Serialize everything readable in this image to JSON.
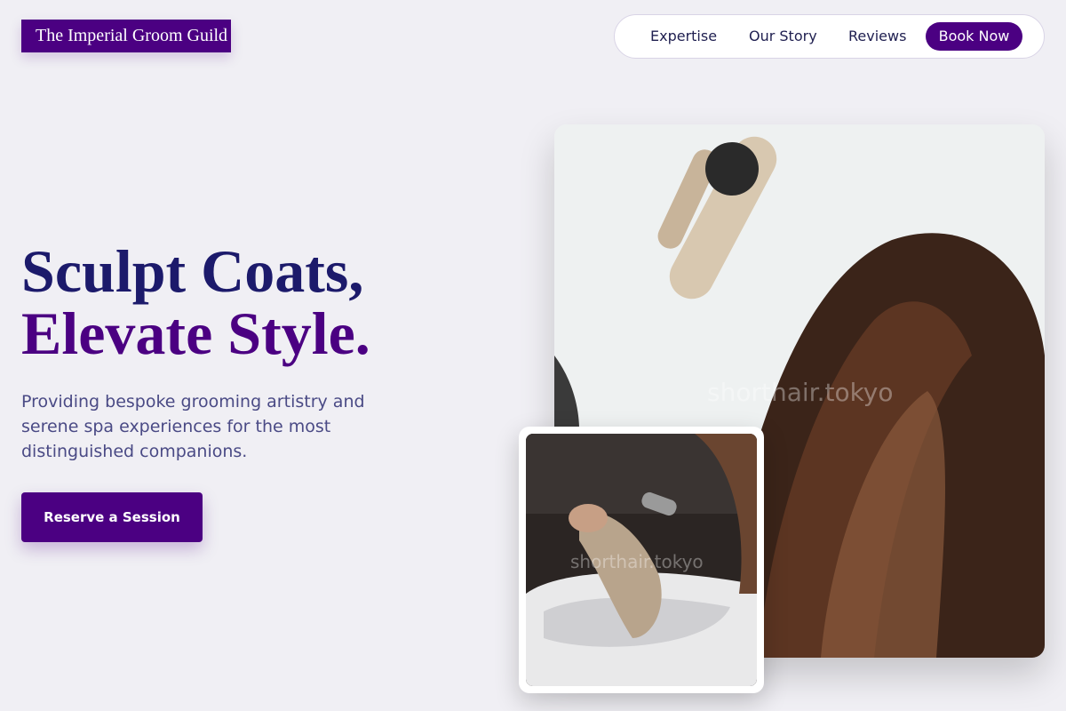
{
  "brand": {
    "name": "The Imperial Groom Guild"
  },
  "nav": {
    "links": [
      "Expertise",
      "Our Story",
      "Reviews"
    ],
    "cta": "Book Now"
  },
  "hero": {
    "headline_line1": "Sculpt Coats,",
    "headline_line2": "Elevate Style.",
    "subtext": "Providing bespoke grooming artistry and serene spa experiences for the most distinguished companions.",
    "cta": "Reserve a Session"
  },
  "images": {
    "main_watermark": "shorthair.tokyo",
    "inset_watermark": "shorthair.tokyo"
  },
  "colors": {
    "accent": "#4b0082",
    "headline_dark": "#1c1a6b",
    "background": "#f0eff4"
  }
}
